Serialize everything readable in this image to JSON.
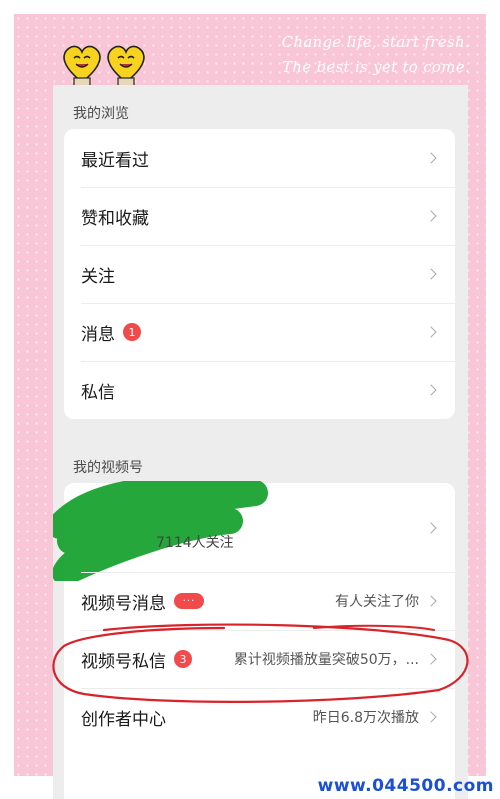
{
  "slogan": {
    "line1": "Change life, start fresh.",
    "line2": "The best is yet to come."
  },
  "browse": {
    "section_title": "我的浏览",
    "items": [
      {
        "label": "最近看过"
      },
      {
        "label": "赞和收藏"
      },
      {
        "label": "关注"
      },
      {
        "label": "消息",
        "badge": "1"
      },
      {
        "label": "私信"
      }
    ]
  },
  "channels": {
    "section_title": "我的视频号",
    "profile": {
      "followers": "7114人关注"
    },
    "items": [
      {
        "label": "视频号消息",
        "badge": "···",
        "value": "有人关注了你"
      },
      {
        "label": "视频号私信",
        "badge": "3",
        "value": "累计视频播放量突破50万，..."
      },
      {
        "label": "创作者中心",
        "value": "昨日6.8万次播放"
      }
    ]
  },
  "watermark": "www.044500.com",
  "colors": {
    "frame_pink": "#f8c6d6",
    "badge_red": "#f24a4a",
    "annotation_red": "#d8232a",
    "watermark_blue": "#1a4fd6"
  }
}
